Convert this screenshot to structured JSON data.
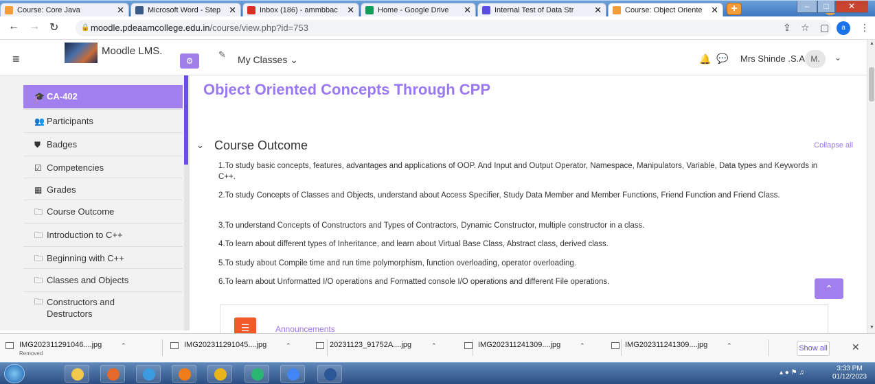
{
  "browser": {
    "tabs": [
      {
        "label": "Course: Core Java",
        "icon_color": "#f29d38"
      },
      {
        "label": "Microsoft Word - Step",
        "icon_color": "#3a5a8a"
      },
      {
        "label": "Inbox (186) - ammbbac",
        "icon_color": "#d93025"
      },
      {
        "label": "Home - Google Drive",
        "icon_color": "#0f9d58"
      },
      {
        "label": "Internal Test of Data Str",
        "icon_color": "#5b4ee0"
      },
      {
        "label": "Course: Object Oriente",
        "icon_color": "#f29d38"
      }
    ],
    "new_tab_label": "+",
    "url_host": "moodle.pdeaamcollege.edu.in",
    "url_path": "/course/view.php?id=753",
    "profile_initial": "a",
    "window_controls": [
      "–",
      "□",
      "✕"
    ]
  },
  "navbar": {
    "site_name": "Moodle LMS.",
    "my_classes": "My Classes ⌄",
    "username": "Mrs Shinde .S.A",
    "avatar_initials": "M."
  },
  "sidebar": {
    "items": [
      {
        "label": "CA-402",
        "icon": "graduation-cap-icon",
        "glyph": "🎓",
        "active": true
      },
      {
        "label": "Participants",
        "icon": "users-icon",
        "glyph": "👥",
        "active": false
      },
      {
        "label": "Badges",
        "icon": "shield-icon",
        "glyph": "⛊",
        "active": false
      },
      {
        "label": "Competencies",
        "icon": "check-square-icon",
        "glyph": "☑",
        "active": false
      },
      {
        "label": "Grades",
        "icon": "table-icon",
        "glyph": "▦",
        "active": false
      },
      {
        "label": "Course Outcome",
        "icon": "folder-icon",
        "glyph": "🗀",
        "active": false
      },
      {
        "label": "Introduction to C++",
        "icon": "folder-icon",
        "glyph": "🗀",
        "active": false
      },
      {
        "label": "Beginning with C++",
        "icon": "folder-icon",
        "glyph": "🗀",
        "active": false
      },
      {
        "label": "Classes and Objects",
        "icon": "folder-icon",
        "glyph": "🗀",
        "active": false
      },
      {
        "label": "Constructors and Destructors",
        "icon": "folder-icon",
        "glyph": "🗀",
        "active": false
      }
    ]
  },
  "main": {
    "page_title": "Object Oriented Concepts Through CPP",
    "section_title": "Course Outcome",
    "collapse_all": "Collapse all",
    "outcomes": [
      "1.To study basic concepts, features, advantages and applications of OOP. And Input and Output Operator, Namespace, Manipulators, Variable, Data types and Keywords in C++.",
      "2.To study Concepts of Classes and Objects, understand about Access Specifier, Study Data Member and Member Functions, Friend Function and Friend Class.",
      "3.To understand Concepts of Constructors and Types of Contractors, Dynamic Constructor, multiple constructor in a class.",
      "4.To learn about different types of Inheritance, and learn about Virtual Base Class, Abstract class, derived class.",
      "5.To study about Compile time and run time polymorphism, function overloading, operator overloading.",
      "6.To learn about Unformatted I/O operations and Formatted console I/O operations and different File operations."
    ],
    "announcements": "Announcements"
  },
  "downloads": {
    "items": [
      {
        "name": "IMG202311291046....jpg",
        "sub": "Removed"
      },
      {
        "name": "IMG202311291045....jpg",
        "sub": ""
      },
      {
        "name": "20231123_91752A....jpg",
        "sub": ""
      },
      {
        "name": "IMG202311241309....jpg",
        "sub": ""
      },
      {
        "name": "IMG202311241309....jpg",
        "sub": ""
      }
    ],
    "show_all": "Show all"
  },
  "taskbar": {
    "time": "3:33 PM",
    "date": "01/12/2023",
    "apps": [
      {
        "name": "file-explorer-icon",
        "color": "#f2c94c"
      },
      {
        "name": "media-player-icon",
        "color": "#e56a2a"
      },
      {
        "name": "internet-explorer-icon",
        "color": "#3b9be0"
      },
      {
        "name": "firefox-icon",
        "color": "#f07c1a"
      },
      {
        "name": "chrome-icon",
        "color": "#e8b41a"
      },
      {
        "name": "app-icon",
        "color": "#2bb673"
      },
      {
        "name": "chrome-icon",
        "color": "#4285f4"
      },
      {
        "name": "word-icon",
        "color": "#2b5797"
      }
    ]
  }
}
